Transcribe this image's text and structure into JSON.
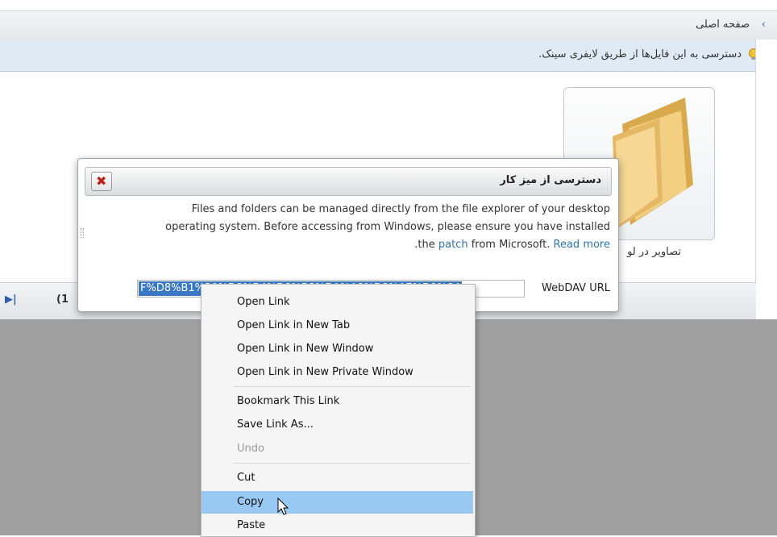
{
  "breadcrumb": {
    "chevron": "‹",
    "home": "صفحه اصلی"
  },
  "info_bar": {
    "icon": "lightbulb-icon",
    "text": "دسترسی به این فایل‌ها از طریق لایفری سینک."
  },
  "folder": {
    "label": "تصاویر در لو"
  },
  "pager": {
    "last_icon": "last-page-icon",
    "info": "(1"
  },
  "dialog": {
    "title": "دسترسی از میز کار",
    "close_icon": "close-icon",
    "body_line1": "Files and folders can be managed directly from the file explorer of your desktop",
    "body_line2": "operating system. Before accessing from Windows, please ensure you have installed",
    "body_prefix": ".the ",
    "patch_link": "patch",
    "body_middle": " from Microsoft. ",
    "read_more_link": "Read more",
    "url_label": "WebDAV URL",
    "url_value": "F%D8%B1%20%D8%B4%D8%B8%DA%A8%D8%A7%D9%84"
  },
  "context_menu": {
    "items": [
      {
        "label": "Open Link",
        "disabled": false
      },
      {
        "label": "Open Link in New Tab",
        "disabled": false
      },
      {
        "label": "Open Link in New Window",
        "disabled": false
      },
      {
        "label": "Open Link in New Private Window",
        "disabled": false
      },
      {
        "label": "Bookmark This Link",
        "disabled": false
      },
      {
        "label": "Save Link As...",
        "disabled": false
      },
      {
        "label": "Undo",
        "disabled": true
      },
      {
        "label": "Cut",
        "disabled": false
      },
      {
        "label": "Copy",
        "disabled": false,
        "highlighted": true
      },
      {
        "label": "Paste",
        "disabled": false
      }
    ]
  },
  "colors": {
    "highlight": "#99c9f3",
    "link": "#2f74b5",
    "selection": "#3a78c3",
    "close_x": "#c0201c"
  }
}
